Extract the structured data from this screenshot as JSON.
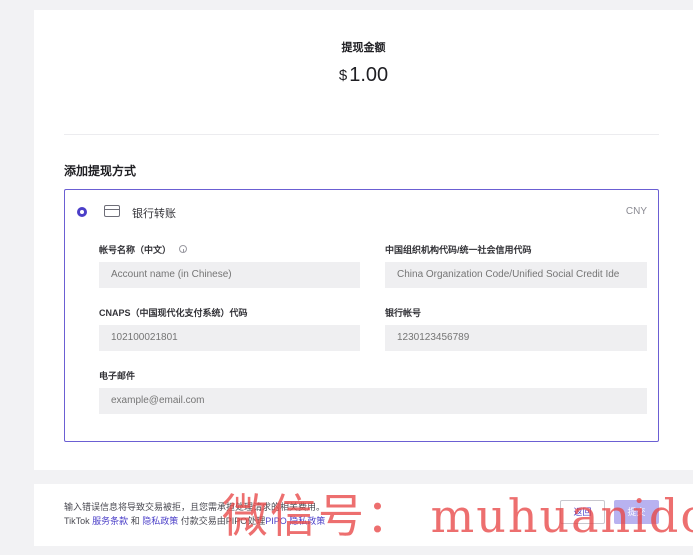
{
  "withdraw": {
    "amount_title": "提现金额",
    "currency_symbol": "$",
    "amount_value": "1.00"
  },
  "method_section": {
    "title": "添加提现方式",
    "method": {
      "name": "银行转账",
      "currency": "CNY",
      "icon": "bank-card-icon",
      "selected": true
    },
    "fields": {
      "account_name": {
        "label": "帐号名称（中文）",
        "placeholder": "Account name (in Chinese)"
      },
      "org_code": {
        "label": "中国组织机构代码/统一社会信用代码",
        "placeholder": "China Organization Code/Unified Social Credit Ide"
      },
      "cnaps": {
        "label": "CNAPS（中国现代化支付系统）代码",
        "placeholder": "102100021801"
      },
      "bank_account": {
        "label": "银行帐号",
        "placeholder": "1230123456789"
      },
      "email": {
        "label": "电子邮件",
        "placeholder": "example@email.com"
      }
    }
  },
  "footer": {
    "line1": "输入错误信息将导致交易被拒，且您需承担处理请求的相关费用。",
    "line2_prefix": "TikTok ",
    "terms_link": "服务条款",
    "and": " 和 ",
    "privacy_link": "隐私政策",
    "line2_mid": " 付款交易由PIPO处理",
    "pipo_privacy_link": "PIPO 隐私政策",
    "back_label": "返回",
    "submit_label": "提交"
  },
  "watermark": {
    "text": "微信号： muhuanidc"
  },
  "colors": {
    "accent": "#4b3fc8",
    "border_accent": "#6b5fd3",
    "submit_disabled": "#b8b2f0",
    "watermark": "#e84646"
  }
}
